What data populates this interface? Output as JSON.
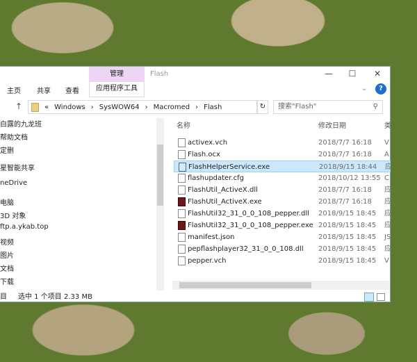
{
  "window": {
    "title": "Flash",
    "context_group": "管理",
    "minimize": "—",
    "maximize": "☐",
    "close": "✕",
    "help": "?",
    "ribbon_toggle": "⌄"
  },
  "ribbon": {
    "tabs": [
      "主页",
      "共享",
      "查看"
    ],
    "context_tab": "应用程序工具"
  },
  "address": {
    "up": "↑",
    "crumbs": [
      "«",
      "Windows",
      "›",
      "SysWOW64",
      "›",
      "Macromed",
      "›",
      "Flash"
    ],
    "refresh": "↻",
    "search_placeholder": "搜索\"Flash\"",
    "search_icon": "⚲"
  },
  "nav": {
    "items": [
      "白露的九龙班",
      "帮助文档",
      "定删",
      "星智能共享",
      "neDrive",
      "电脑",
      "3D 对象",
      "ftp.a.ykab.top",
      "视频",
      "图片",
      "文档",
      "下载"
    ]
  },
  "list": {
    "headers": {
      "name": "名称",
      "date": "修改日期",
      "type": "类"
    },
    "files": [
      {
        "name": "activex.vch",
        "date": "2018/7/7 16:18",
        "type": "V",
        "icon": "doc"
      },
      {
        "name": "Flash.ocx",
        "date": "2018/7/7 16:18",
        "type": "A",
        "icon": "doc"
      },
      {
        "name": "FlashHelperService.exe",
        "date": "2018/9/15 18:44",
        "type": "应",
        "icon": "svc"
      },
      {
        "name": "flashupdater.cfg",
        "date": "2018/10/12 13:55",
        "type": "C",
        "icon": "doc"
      },
      {
        "name": "FlashUtil_ActiveX.dll",
        "date": "2018/7/7 16:18",
        "type": "应",
        "icon": "doc"
      },
      {
        "name": "FlashUtil_ActiveX.exe",
        "date": "2018/7/7 16:18",
        "type": "应",
        "icon": "exe"
      },
      {
        "name": "FlashUtil32_31_0_0_108_pepper.dll",
        "date": "2018/9/15 18:45",
        "type": "应",
        "icon": "doc"
      },
      {
        "name": "FlashUtil32_31_0_0_108_pepper.exe",
        "date": "2018/9/15 18:45",
        "type": "应",
        "icon": "exe"
      },
      {
        "name": "manifest.json",
        "date": "2018/9/15 18:45",
        "type": "JS",
        "icon": "doc"
      },
      {
        "name": "pepflashplayer32_31_0_0_108.dll",
        "date": "2018/9/15 18:45",
        "type": "应",
        "icon": "doc"
      },
      {
        "name": "pepper.vch",
        "date": "2018/9/15 18:45",
        "type": "V",
        "icon": "doc"
      }
    ],
    "selected_index": 2
  },
  "status": {
    "items": "目",
    "selected": "选中 1 个项目",
    "size": "2.33 MB"
  }
}
